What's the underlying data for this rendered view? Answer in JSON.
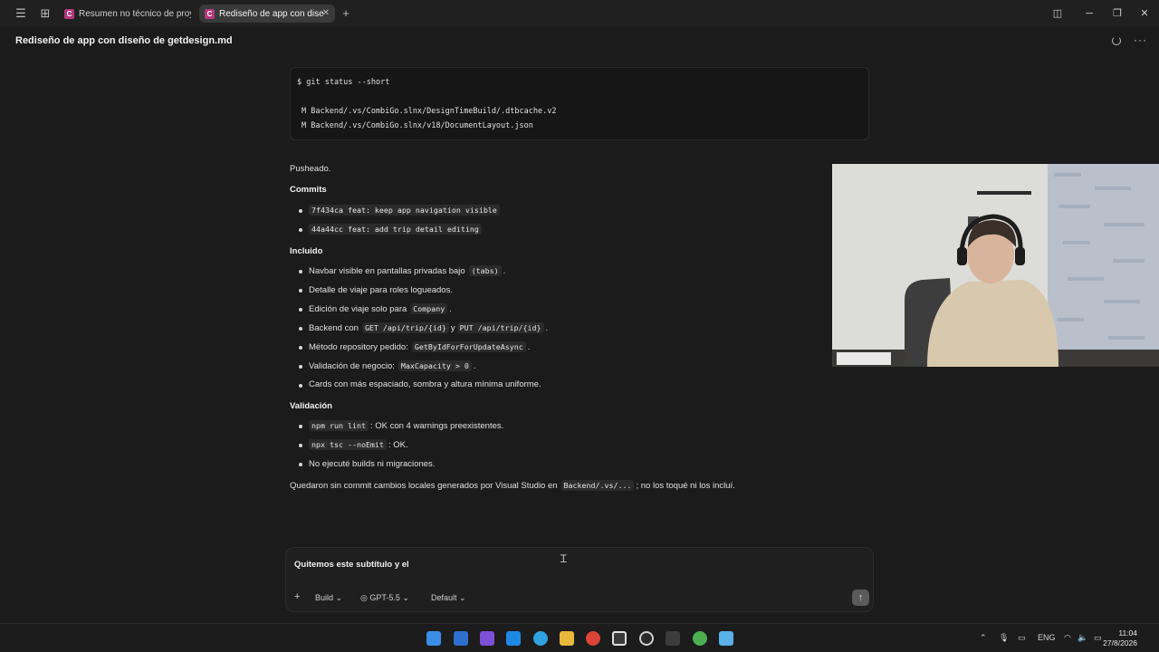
{
  "tabs": [
    {
      "badge": "C",
      "label": "Resumen no técnico de proye",
      "active": false
    },
    {
      "badge": "C",
      "label": "Rediseño de app con dise",
      "active": true
    }
  ],
  "new_tab": "+",
  "header": {
    "title": "Rediseño de app con diseño de getdesign.md",
    "more": "···"
  },
  "code_block": {
    "lines": [
      "$ git status --short",
      "M Backend/.vs/CombiGo.slnx/DesignTimeBuild/.dtbcache.v2",
      "M Backend/.vs/CombiGo.slnx/v18/DocumentLayout.json"
    ]
  },
  "message": {
    "pushed": "Pusheado.",
    "commits_heading": "Commits",
    "commits": [
      "7f434ca feat: keep app navigation visible",
      "44a44cc feat: add trip detail editing"
    ],
    "included_heading": "Incluido",
    "included": [
      {
        "pre": "Navbar visible en pantallas privadas bajo",
        "code": "(tabs)",
        "post": "."
      },
      {
        "pre": "Detalle de viaje para roles logueados.",
        "code": "",
        "post": ""
      },
      {
        "pre": "Edición de viaje solo para",
        "code": "Company",
        "post": "."
      },
      {
        "pre": "Backend con",
        "code": "GET /api/trip/{id}",
        "mid": "y",
        "code2": "PUT /api/trip/{id}",
        "post": "."
      },
      {
        "pre": "Método repository pedido:",
        "code": "GetByIdForForUpdateAsync",
        "post": "."
      },
      {
        "pre": "Validación de negocio:",
        "code": "MaxCapacity > 0",
        "post": "."
      },
      {
        "pre": "Cards con más espaciado, sombra y altura mínima uniforme.",
        "code": "",
        "post": ""
      }
    ],
    "validation_heading": "Validación",
    "validation": [
      {
        "code": "npm run lint",
        "post": ": OK con 4 warnings preexistentes."
      },
      {
        "code": "npx tsc --noEmit",
        "post": ": OK."
      },
      {
        "code": "",
        "post": "No ejecuté builds ni migraciones."
      }
    ],
    "footer_pre": "Quedaron sin commit cambios locales generados por Visual Studio en",
    "footer_code": "Backend/.vs/...",
    "footer_post": "; no los toqué ni los incluí."
  },
  "composer": {
    "text": "Quitemos este subtítulo y el",
    "add": "+",
    "mode": "Build",
    "model": "GPT-5.5",
    "preset": "Default",
    "send": "↑"
  },
  "taskbar": {
    "lang": "ENG",
    "time": "11:04",
    "date": "27/8/2026"
  },
  "colors": {
    "accent": "#b3387c",
    "background": "#1b1b1b",
    "code_bg": "#2b2b2b"
  }
}
